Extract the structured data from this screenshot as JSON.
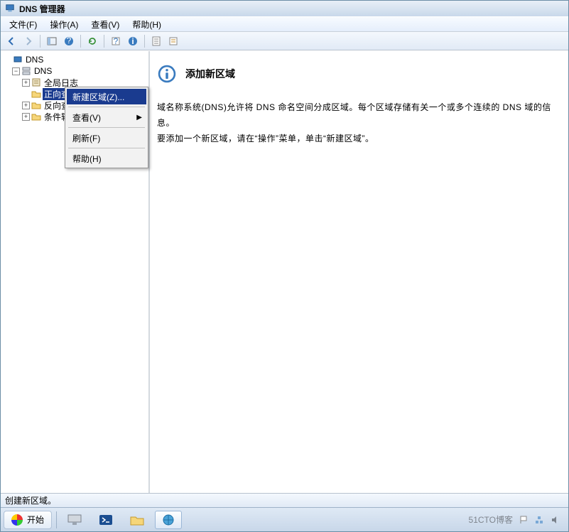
{
  "window": {
    "title": "DNS 管理器"
  },
  "menubar": {
    "file": "文件(F)",
    "action": "操作(A)",
    "view": "查看(V)",
    "help": "帮助(H)"
  },
  "tree": {
    "root": "DNS",
    "server": "DNS",
    "global_log": "全局日志",
    "fwd_zone": "正向查找区域",
    "rev_zone": "反向查找区域",
    "cond_fwd": "条件转发器"
  },
  "context_menu": {
    "new_zone": "新建区域(Z)...",
    "view": "查看(V)",
    "refresh": "刷新(F)",
    "help": "帮助(H)"
  },
  "main": {
    "title": "添加新区域",
    "p1": "域名称系统(DNS)允许将 DNS 命名空间分成区域。每个区域存储有关一个或多个连续的 DNS 域的信息。",
    "p2": "要添加一个新区域，请在“操作”菜单，单击“新建区域”。"
  },
  "statusbar": {
    "text": "创建新区域。"
  },
  "taskbar": {
    "start": "开始",
    "tray_text": "51CTO博客"
  }
}
